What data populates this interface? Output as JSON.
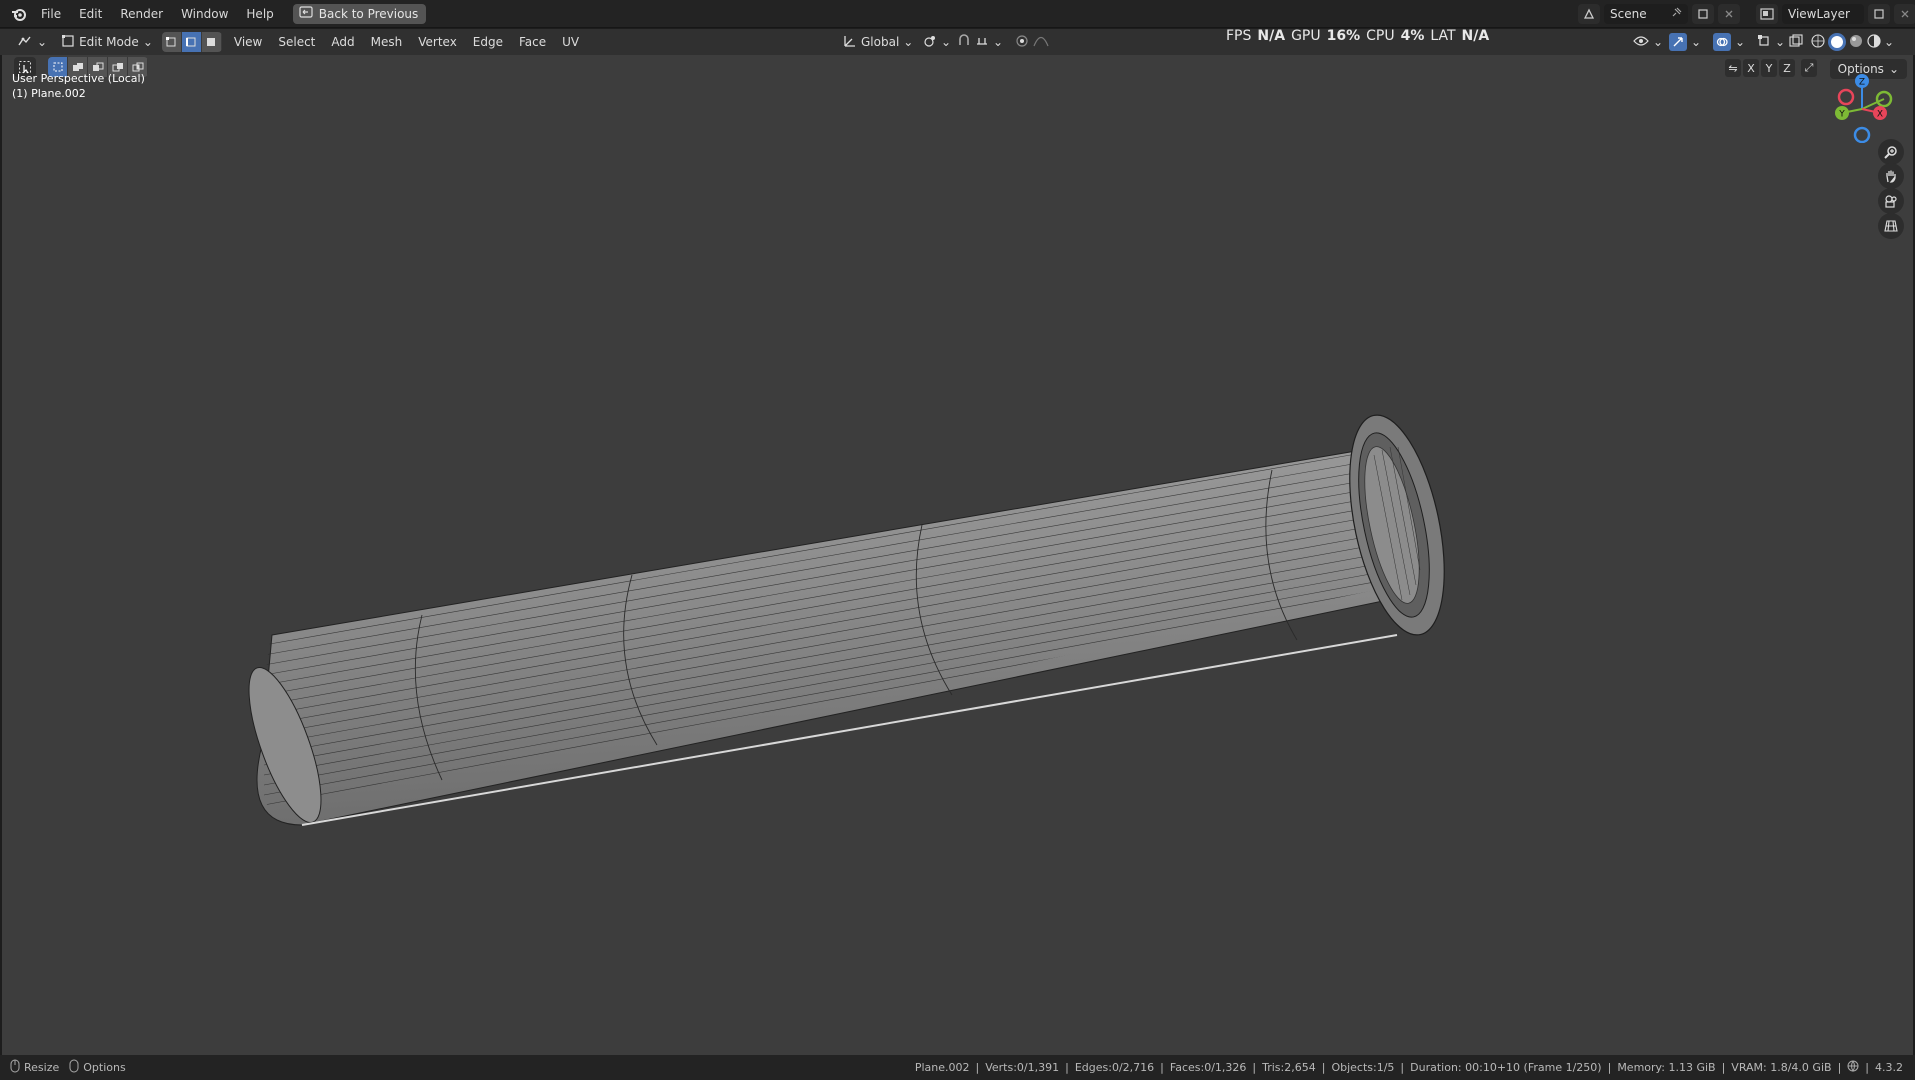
{
  "topbar": {
    "menus": [
      "File",
      "Edit",
      "Render",
      "Window",
      "Help"
    ],
    "back_button": "Back to Previous",
    "scene": "Scene",
    "view_layer": "ViewLayer"
  },
  "performance": {
    "fps_label": "FPS",
    "fps_value": "N/A",
    "gpu_label": "GPU",
    "gpu_value": "16%",
    "cpu_label": "CPU",
    "cpu_value": "4%",
    "lat_label": "LAT",
    "lat_value": "N/A"
  },
  "header": {
    "mode": "Edit Mode",
    "menus": [
      "View",
      "Select",
      "Add",
      "Mesh",
      "Vertex",
      "Edge",
      "Face",
      "UV"
    ],
    "orientation": "Global"
  },
  "viewport": {
    "view_name": "User Perspective (Local)",
    "object_name": "(1) Plane.002",
    "options_label": "Options",
    "axes": [
      "X",
      "Y",
      "Z"
    ],
    "gizmo_labels": {
      "z": "Z",
      "y": "Y",
      "x": "X"
    }
  },
  "statusbar": {
    "left_actions": [
      "Resize",
      "Options"
    ],
    "object": "Plane.002",
    "verts": "Verts:0/1,391",
    "edges": "Edges:0/2,716",
    "faces": "Faces:0/1,326",
    "tris": "Tris:2,654",
    "objects": "Objects:1/5",
    "duration": "Duration: 00:10+10 (Frame 1/250)",
    "memory": "Memory: 1.13 GiB",
    "vram": "VRAM: 1.8/4.0 GiB",
    "version": "4.3.2"
  },
  "colors": {
    "accent": "#4772b3",
    "viewport_bg": "#3d3d3d",
    "axis_x": "#e8455a",
    "axis_y": "#7dba35",
    "axis_z": "#3c8ce6"
  }
}
